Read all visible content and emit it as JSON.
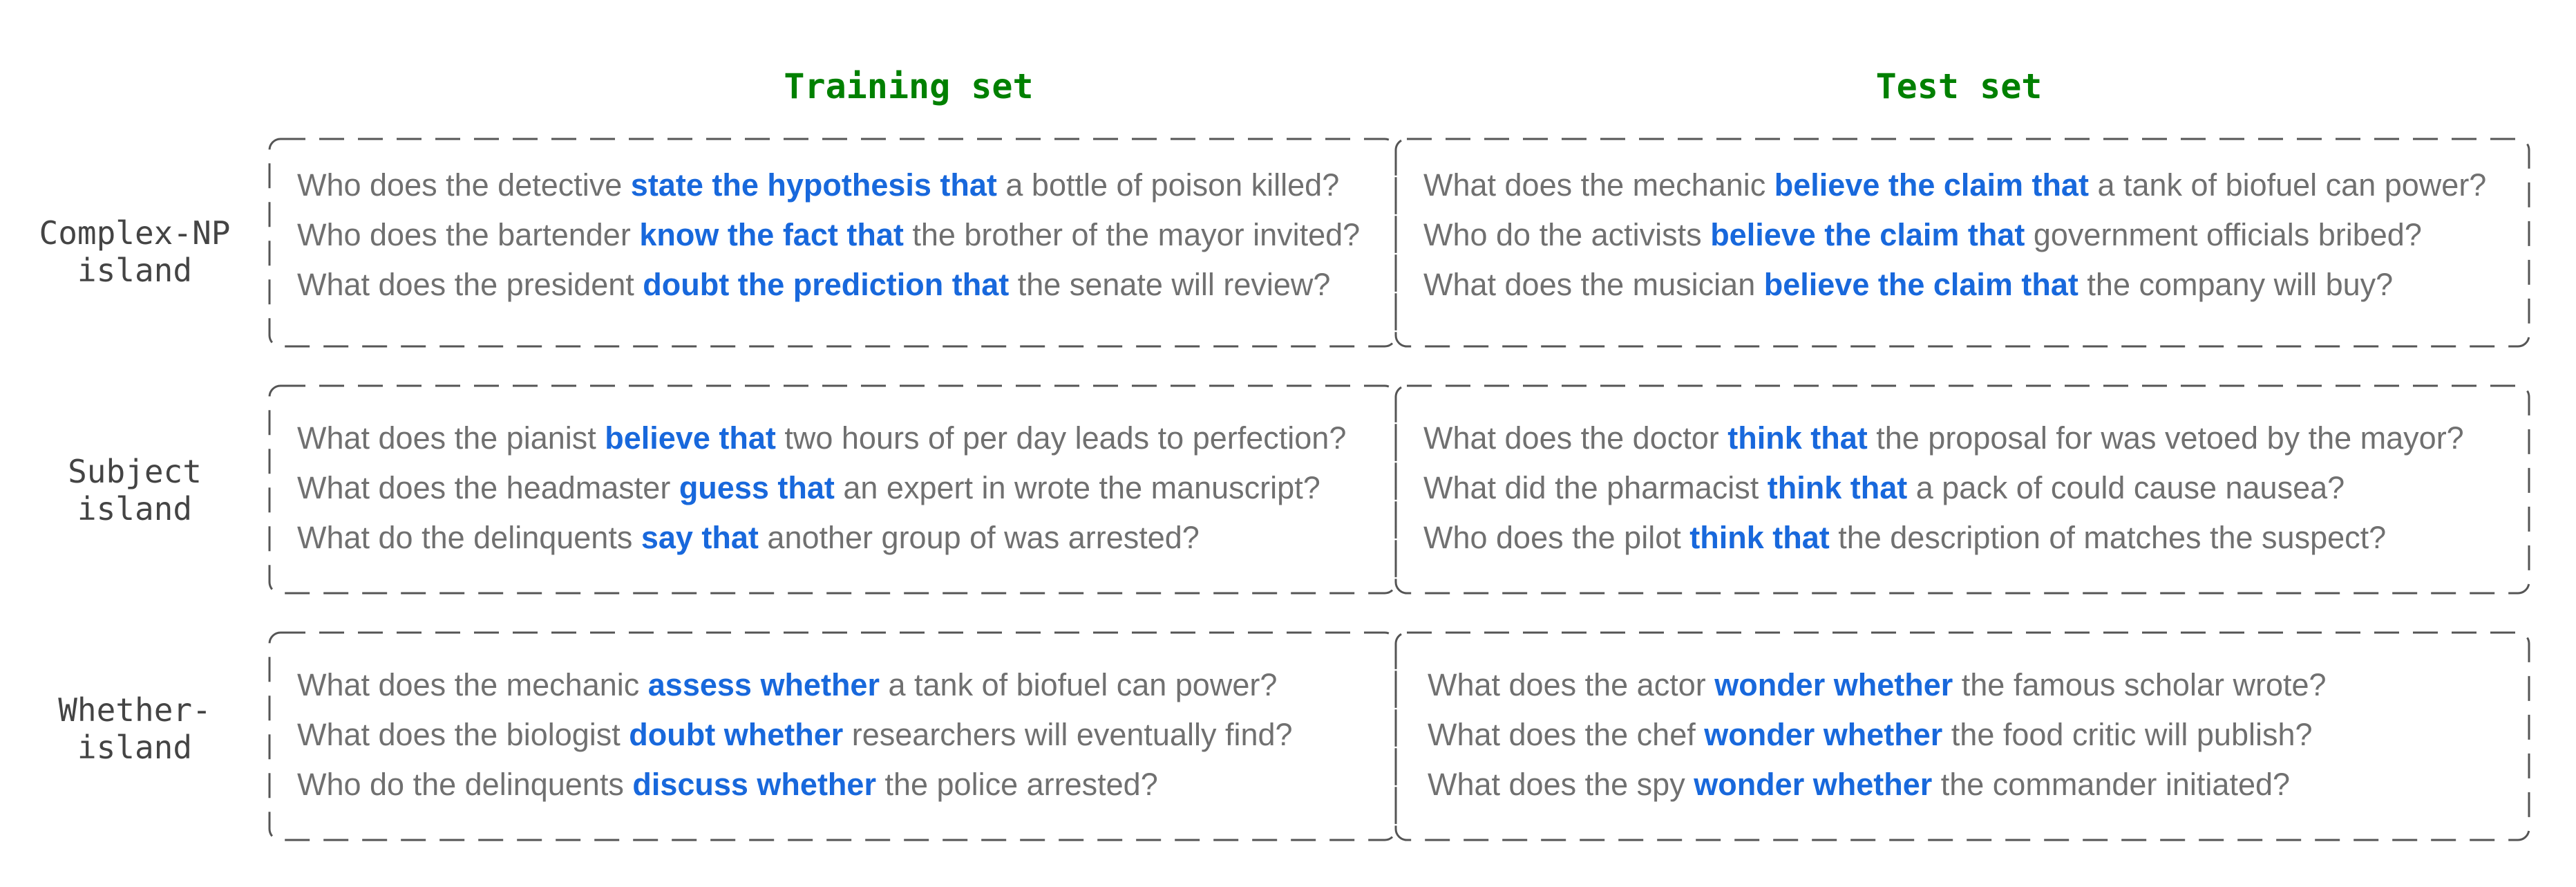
{
  "columns": {
    "training": "Training set",
    "test": "Test set"
  },
  "rows": [
    {
      "label_lines": [
        "Complex-NP",
        "island"
      ],
      "training": [
        {
          "pre": "Who does the detective ",
          "hl": "state the hypothesis that",
          "post": " a bottle of poison killed?"
        },
        {
          "pre": "Who does the bartender ",
          "hl": "know the fact that",
          "post": " the brother of the mayor invited?"
        },
        {
          "pre": "What does the president ",
          "hl": "doubt the prediction that",
          "post": " the senate will review?"
        }
      ],
      "test": [
        {
          "pre": "What does the mechanic ",
          "hl": "believe the claim that",
          "post": " a tank of biofuel can power?"
        },
        {
          "pre": "Who do the activists ",
          "hl": "believe the claim that",
          "post": " government officials bribed?"
        },
        {
          "pre": "What does the musician ",
          "hl": "believe the claim that",
          "post": " the company will buy?"
        }
      ]
    },
    {
      "label_lines": [
        "Subject",
        "island"
      ],
      "training": [
        {
          "pre": "What does the pianist ",
          "hl": "believe that",
          "post": " two hours of per day leads to perfection?"
        },
        {
          "pre": "What does the headmaster ",
          "hl": "guess that",
          "post": " an expert in wrote the manuscript?"
        },
        {
          "pre": "What do the delinquents ",
          "hl": "say that",
          "post": " another group of was arrested?"
        }
      ],
      "test": [
        {
          "pre": "What does the doctor ",
          "hl": "think that",
          "post": " the proposal for was vetoed by the mayor?"
        },
        {
          "pre": "What did the pharmacist ",
          "hl": "think that",
          "post": " a pack of could cause nausea?"
        },
        {
          "pre": "Who does the pilot ",
          "hl": "think that",
          "post": " the description of matches the suspect?"
        }
      ]
    },
    {
      "label_lines": [
        "Whether-",
        "island"
      ],
      "training": [
        {
          "pre": "What does the mechanic ",
          "hl": "assess whether",
          "post": " a tank of biofuel can power?"
        },
        {
          "pre": "What does the biologist ",
          "hl": "doubt whether",
          "post": " researchers will eventually find?"
        },
        {
          "pre": "Who do the delinquents ",
          "hl": "discuss whether",
          "post": " the police arrested?"
        }
      ],
      "test": [
        {
          "pre": "What does the actor ",
          "hl": "wonder whether",
          "post": " the famous scholar wrote?"
        },
        {
          "pre": "What does the chef ",
          "hl": "wonder whether",
          "post": " the food critic will publish?"
        },
        {
          "pre": "What does the spy ",
          "hl": "wonder whether",
          "post": " the commander initiated?"
        }
      ]
    }
  ],
  "colors": {
    "header": "#008000",
    "highlight": "#1868dc",
    "text": "#707070",
    "label": "#444444",
    "frame": "#555555"
  }
}
